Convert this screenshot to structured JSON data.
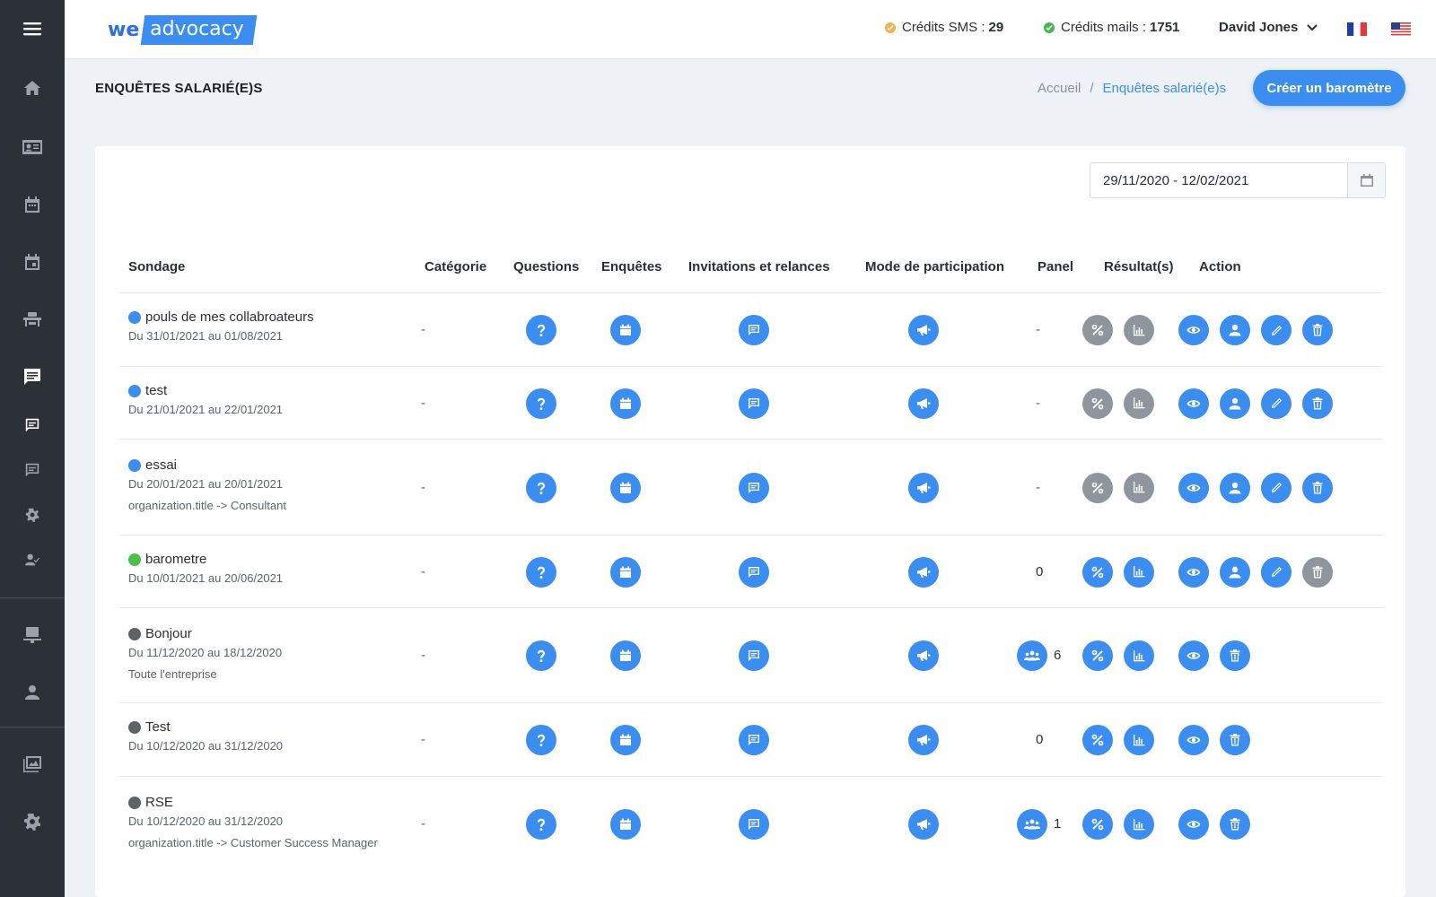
{
  "topbar": {
    "logo_we": "we",
    "logo_advocacy": "advocacy",
    "sms_label": "Crédits SMS :",
    "sms_value": "29",
    "mail_label": "Crédits mails :",
    "mail_value": "1751",
    "user_name": "David Jones",
    "colors": {
      "sms_dot": "#f0b44c",
      "mail_dot": "#3fb950"
    }
  },
  "page": {
    "title": "ENQUÊTES SALARIÉ(E)S",
    "breadcrumb_home": "Accueil",
    "breadcrumb_sep": "/",
    "breadcrumb_current": "Enquêtes salarié(e)s",
    "cta_label": "Créer un baromètre"
  },
  "filter": {
    "date_range": "29/11/2020 - 12/02/2021"
  },
  "table": {
    "headers": {
      "sondage": "Sondage",
      "categorie": "Catégorie",
      "questions": "Questions",
      "enquetes": "Enquêtes",
      "invitations": "Invitations et relances",
      "mode": "Mode de participation",
      "panel": "Panel",
      "resultats": "Résultat(s)",
      "action": "Action"
    },
    "rows": [
      {
        "name": "pouls de mes collabroateurs",
        "dates": "Du 31/01/2021 au 01/08/2021",
        "extra": "",
        "category": "-",
        "status_color": "#3b8df0",
        "panel": "-",
        "panel_icon": false,
        "results_enabled": false,
        "actions": [
          "view",
          "user",
          "edit",
          "delete"
        ],
        "delete_disabled": false
      },
      {
        "name": "test",
        "dates": "Du 21/01/2021 au 22/01/2021",
        "extra": "",
        "category": "-",
        "status_color": "#3b8df0",
        "panel": "-",
        "panel_icon": false,
        "results_enabled": false,
        "actions": [
          "view",
          "user",
          "edit",
          "delete"
        ],
        "delete_disabled": false
      },
      {
        "name": "essai",
        "dates": "Du 20/01/2021 au 20/01/2021",
        "extra": "organization.title -> Consultant",
        "category": "-",
        "status_color": "#3b8df0",
        "panel": "-",
        "panel_icon": false,
        "results_enabled": false,
        "actions": [
          "view",
          "user",
          "edit",
          "delete"
        ],
        "delete_disabled": false
      },
      {
        "name": "barometre",
        "dates": "Du 10/01/2021 au 20/06/2021",
        "extra": "",
        "category": "-",
        "status_color": "#4cbf4a",
        "panel": "0",
        "panel_icon": false,
        "results_enabled": true,
        "actions": [
          "view",
          "user",
          "edit",
          "delete"
        ],
        "delete_disabled": true
      },
      {
        "name": "Bonjour",
        "dates": "Du 11/12/2020 au 18/12/2020",
        "extra": "Toute l'entreprise",
        "category": "-",
        "status_color": "#5f6368",
        "panel": "6",
        "panel_icon": true,
        "results_enabled": true,
        "actions": [
          "view",
          "delete"
        ],
        "delete_disabled": false
      },
      {
        "name": "Test",
        "dates": "Du 10/12/2020 au 31/12/2020",
        "extra": "",
        "category": "-",
        "status_color": "#5f6368",
        "panel": "0",
        "panel_icon": false,
        "results_enabled": true,
        "actions": [
          "view",
          "delete"
        ],
        "delete_disabled": false
      },
      {
        "name": "RSE",
        "dates": "Du 10/12/2020 au 31/12/2020",
        "extra": "organization.title -> Customer Success Manager",
        "category": "-",
        "status_color": "#5f6368",
        "panel": "1",
        "panel_icon": true,
        "results_enabled": true,
        "actions": [
          "view",
          "delete"
        ],
        "delete_disabled": false
      }
    ]
  }
}
